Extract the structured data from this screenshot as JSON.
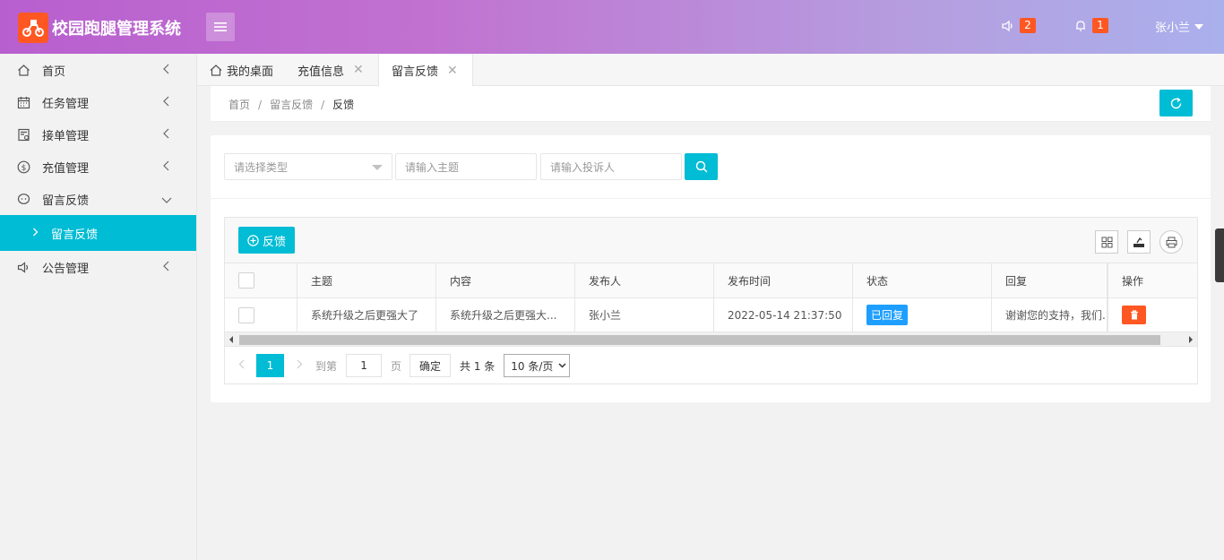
{
  "header": {
    "app_title": "校园跑腿管理系统",
    "notice_count": "2",
    "alert_count": "1",
    "user_name": "张小兰"
  },
  "sidebar": {
    "items": [
      {
        "label": "首页",
        "icon": "home-icon"
      },
      {
        "label": "任务管理",
        "icon": "calendar-icon"
      },
      {
        "label": "接单管理",
        "icon": "order-icon"
      },
      {
        "label": "充值管理",
        "icon": "dollar-icon"
      },
      {
        "label": "留言反馈",
        "icon": "chat-icon",
        "expanded": true
      },
      {
        "label": "公告管理",
        "icon": "speaker-icon"
      }
    ],
    "sub_item": "留言反馈"
  },
  "tabs": [
    {
      "label": "我的桌面"
    },
    {
      "label": "充值信息"
    },
    {
      "label": "留言反馈",
      "active": true
    }
  ],
  "breadcrumb": {
    "home": "首页",
    "section": "留言反馈",
    "current": "反馈"
  },
  "search": {
    "type_placeholder": "请选择类型",
    "subject_placeholder": "请输入主题",
    "complainant_placeholder": "请输入投诉人"
  },
  "toolbar": {
    "add_label": "反馈"
  },
  "table": {
    "columns": [
      "主题",
      "内容",
      "发布人",
      "发布时间",
      "状态",
      "回复",
      "操作"
    ],
    "rows": [
      {
        "subject": "系统升级之后更强大了",
        "content": "系统升级之后更强大...",
        "publisher": "张小兰",
        "time": "2022-05-14 21:37:50",
        "status": "已回复",
        "reply": "谢谢您的支持，我们..."
      }
    ]
  },
  "pager": {
    "current_page": "1",
    "goto_label": "到第",
    "goto_value": "1",
    "page_label": "页",
    "confirm_label": "确定",
    "total_label": "共 1 条",
    "page_size": "10 条/页"
  },
  "colors": {
    "accent": "#00bcd4",
    "danger": "#ff5722",
    "info": "#1e9fff"
  }
}
